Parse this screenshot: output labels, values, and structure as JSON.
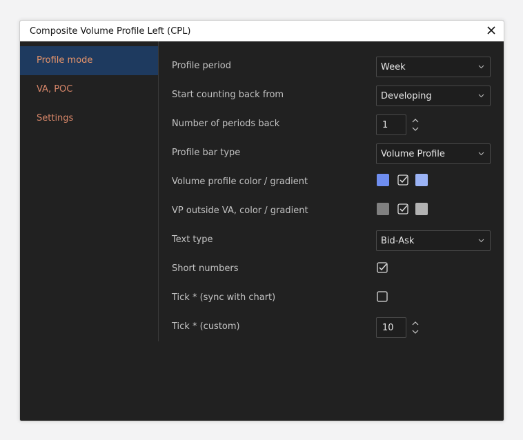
{
  "window": {
    "title": "Composite Volume Profile Left (CPL)"
  },
  "sidebar": {
    "items": [
      {
        "label": "Profile mode"
      },
      {
        "label": "VA, POC"
      },
      {
        "label": "Settings"
      }
    ]
  },
  "settings": {
    "profile_period": {
      "label": "Profile period",
      "value": "Week"
    },
    "start_counting": {
      "label": "Start counting back from",
      "value": "Developing"
    },
    "periods_back": {
      "label": "Number of periods back",
      "value": "1"
    },
    "bar_type": {
      "label": "Profile bar type",
      "value": "Volume Profile"
    },
    "vp_color": {
      "label": "Volume profile color / gradient",
      "color1": "#6f8ef0",
      "gradient_checked": true,
      "color2": "#9bb3f5"
    },
    "vp_outside": {
      "label": "VP outside VA, color / gradient",
      "color1": "#808080",
      "gradient_checked": true,
      "color2": "#b3b3b3"
    },
    "text_type": {
      "label": "Text type",
      "value": "Bid-Ask"
    },
    "short_numbers": {
      "label": "Short numbers",
      "checked": true
    },
    "tick_sync": {
      "label": "Tick * (sync with chart)",
      "checked": false
    },
    "tick_custom": {
      "label": "Tick * (custom)",
      "value": "10"
    }
  },
  "colors": {
    "accent_text": "#d8876a",
    "active_bg": "#1e3a5f",
    "panel_bg": "#212121"
  }
}
